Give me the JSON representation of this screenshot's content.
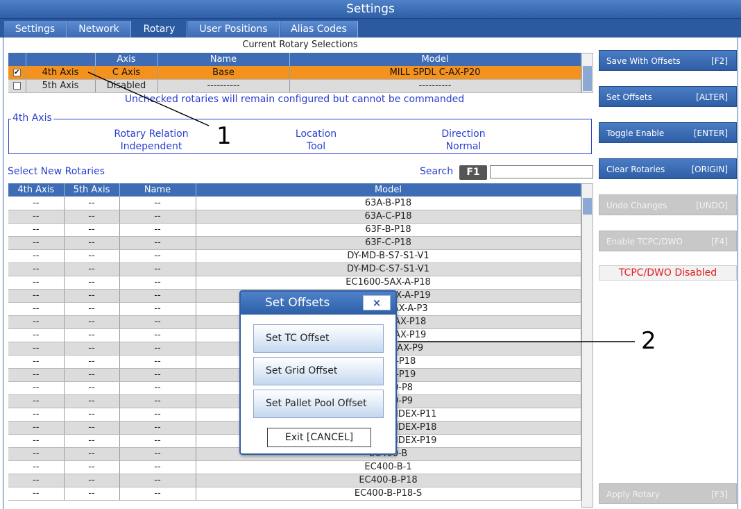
{
  "window": {
    "title": "Settings"
  },
  "tabs": [
    {
      "label": "Settings"
    },
    {
      "label": "Network"
    },
    {
      "label": "Rotary",
      "active": true
    },
    {
      "label": "User Positions"
    },
    {
      "label": "Alias Codes"
    }
  ],
  "current": {
    "title": "Current Rotary Selections",
    "headers": [
      "",
      "",
      "Axis",
      "Name",
      "Model"
    ],
    "rows": [
      {
        "checked": true,
        "slot": "4th Axis",
        "axis": "C Axis",
        "name": "Base",
        "model": "MILL SPDL C-AX-P20",
        "selected": true
      },
      {
        "checked": false,
        "slot": "5th Axis",
        "axis": "Disabled",
        "name": "----------",
        "model": "----------",
        "selected": false
      }
    ],
    "note": "Unchecked rotaries will remain configured but cannot be commanded"
  },
  "axis_detail": {
    "legend": "4th Axis",
    "columns": [
      {
        "label": "Rotary Relation",
        "value": "Independent"
      },
      {
        "label": "Location",
        "value": "Tool"
      },
      {
        "label": "Direction",
        "value": "Normal"
      }
    ]
  },
  "new_rotaries": {
    "title": "Select New Rotaries",
    "search_label": "Search",
    "search_key": "F1",
    "search_value": "",
    "headers": [
      "4th Axis",
      "5th Axis",
      "Name",
      "Model"
    ],
    "rows": [
      {
        "a4": "--",
        "a5": "--",
        "name": "--",
        "model": "63A-B-P18"
      },
      {
        "a4": "--",
        "a5": "--",
        "name": "--",
        "model": "63A-C-P18"
      },
      {
        "a4": "--",
        "a5": "--",
        "name": "--",
        "model": "63F-B-P18"
      },
      {
        "a4": "--",
        "a5": "--",
        "name": "--",
        "model": "63F-C-P18"
      },
      {
        "a4": "--",
        "a5": "--",
        "name": "--",
        "model": "DY-MD-B-S7-S1-V1"
      },
      {
        "a4": "--",
        "a5": "--",
        "name": "--",
        "model": "DY-MD-C-S7-S1-V1"
      },
      {
        "a4": "--",
        "a5": "--",
        "name": "--",
        "model": "EC1600-5AX-A-P18"
      },
      {
        "a4": "--",
        "a5": "--",
        "name": "--",
        "model": "EC1600-5AX-A-P19"
      },
      {
        "a4": "--",
        "a5": "--",
        "name": "--",
        "model": "EC1600-5AX-A-P3"
      },
      {
        "a4": "--",
        "a5": "--",
        "name": "--",
        "model": "EC1600-5AX-P18"
      },
      {
        "a4": "--",
        "a5": "--",
        "name": "--",
        "model": "EC1600-5AX-P19"
      },
      {
        "a4": "--",
        "a5": "--",
        "name": "--",
        "model": "EC1600-5AX-P9"
      },
      {
        "a4": "--",
        "a5": "--",
        "name": "--",
        "model": "EC1600-P18"
      },
      {
        "a4": "--",
        "a5": "--",
        "name": "--",
        "model": "EC1600-P19"
      },
      {
        "a4": "--",
        "a5": "--",
        "name": "--",
        "model": "EC1600-P8"
      },
      {
        "a4": "--",
        "a5": "--",
        "name": "--",
        "model": "EC1600-P9"
      },
      {
        "a4": "--",
        "a5": "--",
        "name": "--",
        "model": "EC1600ZT-INDEX-P11"
      },
      {
        "a4": "--",
        "a5": "--",
        "name": "--",
        "model": "EC1600ZT-INDEX-P18"
      },
      {
        "a4": "--",
        "a5": "--",
        "name": "--",
        "model": "EC1600ZT-INDEX-P19"
      },
      {
        "a4": "--",
        "a5": "--",
        "name": "--",
        "model": "EC400-B"
      },
      {
        "a4": "--",
        "a5": "--",
        "name": "--",
        "model": "EC400-B-1"
      },
      {
        "a4": "--",
        "a5": "--",
        "name": "--",
        "model": "EC400-B-P18"
      },
      {
        "a4": "--",
        "a5": "--",
        "name": "--",
        "model": "EC400-B-P18-S"
      }
    ]
  },
  "side_buttons": [
    {
      "label": "Save With Offsets",
      "key": "[F2]",
      "enabled": true
    },
    {
      "label": "Set Offsets",
      "key": "[ALTER]",
      "enabled": true
    },
    {
      "label": "Toggle Enable",
      "key": "[ENTER]",
      "enabled": true
    },
    {
      "label": "Clear Rotaries",
      "key": "[ORIGIN]",
      "enabled": true
    },
    {
      "label": "Undo Changes",
      "key": "[UNDO]",
      "enabled": false
    },
    {
      "label": "Enable TCPC/DWO",
      "key": "[F4]",
      "enabled": false
    }
  ],
  "tcpc_status": "TCPC/DWO Disabled",
  "apply_button": {
    "label": "Apply Rotary",
    "key": "[F3]",
    "enabled": false
  },
  "dialog": {
    "title": "Set Offsets",
    "close": "×",
    "buttons": [
      "Set TC Offset",
      "Set Grid Offset",
      "Set Pallet Pool Offset"
    ],
    "exit": "Exit [CANCEL]"
  },
  "callouts": [
    "1",
    "2"
  ],
  "colors": {
    "accent": "#2e5fa8",
    "selected_row": "#f5921e",
    "status_red": "#e11b1b",
    "info_blue": "#2a3fcf"
  }
}
